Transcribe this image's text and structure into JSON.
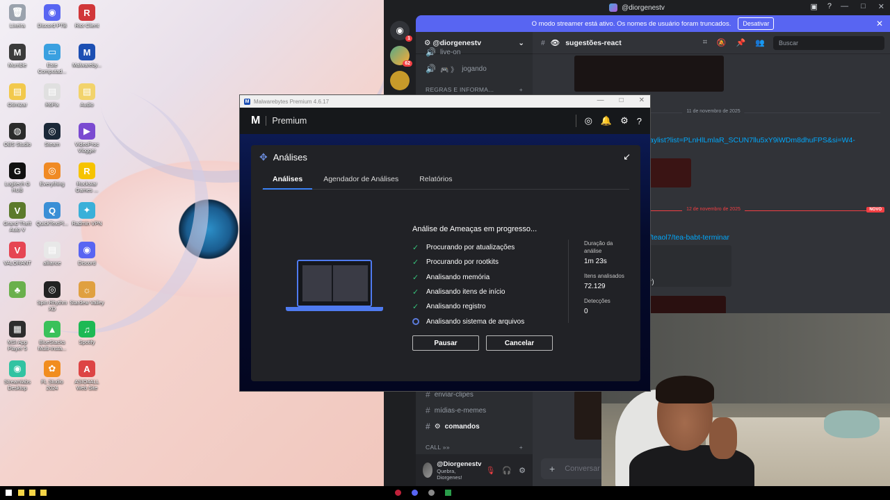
{
  "desktop": {
    "icons": [
      {
        "label": "Lixeira",
        "color": "#9aa2ad",
        "glyph": "🗑"
      },
      {
        "label": "Discord PTB",
        "color": "#5865f2",
        "glyph": "◉"
      },
      {
        "label": "Riot Client",
        "color": "#d13639",
        "glyph": "R"
      },
      {
        "label": "Mumble",
        "color": "#3b3b3b",
        "glyph": "M"
      },
      {
        "label": "Este Computad...",
        "color": "#3aa0e0",
        "glyph": "▭"
      },
      {
        "label": "Malwareby...",
        "color": "#1c4fb3",
        "glyph": "M"
      },
      {
        "label": "Otimizar",
        "color": "#f2c94c",
        "glyph": "▤"
      },
      {
        "label": "R6Fix",
        "color": "#e0e0e0",
        "glyph": "▤"
      },
      {
        "label": "Audio",
        "color": "#f2d36b",
        "glyph": "▤"
      },
      {
        "label": "OBS Studio",
        "color": "#2b2b2b",
        "glyph": "◍"
      },
      {
        "label": "Steam",
        "color": "#1b2838",
        "glyph": "◎"
      },
      {
        "label": "VideoProc Vlogger",
        "color": "#7b4ad1",
        "glyph": "▶"
      },
      {
        "label": "Logitech G HUB",
        "color": "#111111",
        "glyph": "G"
      },
      {
        "label": "Everything",
        "color": "#f08a24",
        "glyph": "◎"
      },
      {
        "label": "Rockstar Games ...",
        "color": "#f6c300",
        "glyph": "R"
      },
      {
        "label": "Grand Theft Auto V",
        "color": "#5c7a2b",
        "glyph": "V"
      },
      {
        "label": "QuickTextPl...",
        "color": "#3a8fd6",
        "glyph": "Q"
      },
      {
        "label": "Radmin VPN",
        "color": "#3ab0d9",
        "glyph": "✦"
      },
      {
        "label": "VALORANT",
        "color": "#e64553",
        "glyph": "V"
      },
      {
        "label": "alliance",
        "color": "#e8e8e8",
        "glyph": "▤"
      },
      {
        "label": "Discord",
        "color": "#5865f2",
        "glyph": "◉"
      },
      {
        "label": "",
        "color": "#6ab04c",
        "glyph": "♣"
      },
      {
        "label": "Spin Rhythm XD",
        "color": "#222222",
        "glyph": "◎"
      },
      {
        "label": "Stardew Valley",
        "color": "#e0a040",
        "glyph": "☼"
      },
      {
        "label": "MSI App Player 5",
        "color": "#2d2d2d",
        "glyph": "▦"
      },
      {
        "label": "BlueStacks Multi-Insta...",
        "color": "#3ac15a",
        "glyph": "▲"
      },
      {
        "label": "Spotify",
        "color": "#1db954",
        "glyph": "♫"
      },
      {
        "label": "Streamlabs Desktop",
        "color": "#31c3a2",
        "glyph": "◉"
      },
      {
        "label": "FL Studio 2024",
        "color": "#f18d1f",
        "glyph": "✿"
      },
      {
        "label": "ASIO4ALL Web Site",
        "color": "#d44",
        "glyph": "A"
      }
    ]
  },
  "discord": {
    "title_user": "@diorgenestv",
    "server_badge": "1",
    "server_badge2": "62",
    "banner_text": "O modo streamer está ativo. Os nomes de usuário foram truncados.",
    "banner_button": "Desativar",
    "server_name": "@diorgenestv",
    "channel_partial": "live-on",
    "channel_jogando": "jogando",
    "category_regras": "REGRAS E INFORMA...",
    "channel_header": "sugestões-react",
    "search_placeholder": "Buscar",
    "channels_bottom": [
      {
        "name": "enviar-clipes"
      },
      {
        "name": "mídias-e-memes"
      },
      {
        "name": "comandos"
      }
    ],
    "category_call": "CALL »»",
    "user_name": "@Diorgenestv",
    "user_status": "Quebra, Diorgenes!",
    "date_1": "11 de novembro de 2025",
    "date_2": "12 de novembro de 2025",
    "new_badge": "NOVO",
    "link_1": "aylist?list=PLnHlLmlaR_SCUN7llu5xY9iWDm8dhuFPS&si=W4-",
    "link_2": "/teaol7/tea-babt-terminar",
    "text_r": "r)",
    "input_placeholder": "Conversar"
  },
  "malwarebytes": {
    "window_title": "Malwarebytes Premium 4.6.17",
    "brand": "Premium",
    "card_title": "Análises",
    "tabs": [
      "Análises",
      "Agendador de Análises",
      "Relatórios"
    ],
    "status_title": "Análise de Ameaças em progresso...",
    "steps": [
      {
        "label": "Procurando por atualizações",
        "done": true
      },
      {
        "label": "Procurando por rootkits",
        "done": true
      },
      {
        "label": "Analisando memória",
        "done": true
      },
      {
        "label": "Analisando itens de início",
        "done": true
      },
      {
        "label": "Analisando registro",
        "done": true
      },
      {
        "label": "Analisando sistema de arquivos",
        "done": false
      }
    ],
    "buttons": {
      "pause": "Pausar",
      "cancel": "Cancelar"
    },
    "stats": [
      {
        "label": "Duração da análise",
        "value": "1m 23s"
      },
      {
        "label": "Itens analisados",
        "value": "72.129"
      },
      {
        "label": "Detecções",
        "value": "0"
      }
    ]
  }
}
